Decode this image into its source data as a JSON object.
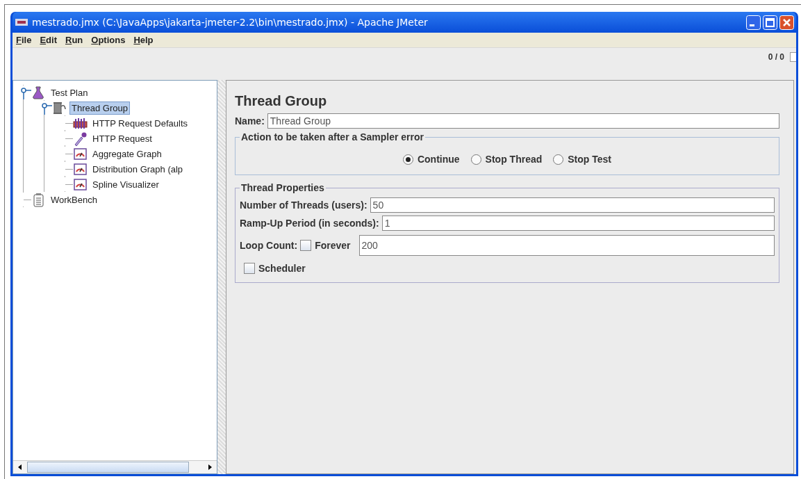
{
  "window": {
    "title": "mestrado.jmx (C:\\JavaApps\\jakarta-jmeter-2.2\\bin\\mestrado.jmx) - Apache JMeter"
  },
  "menu": [
    "File",
    "Edit",
    "Run",
    "Options",
    "Help"
  ],
  "toolbar": {
    "counter": "0 / 0"
  },
  "tree": [
    {
      "label": "Test Plan",
      "kind": "plan",
      "selected": false,
      "expanded": true,
      "children": [
        {
          "label": "Thread Group",
          "kind": "thread-group",
          "selected": true,
          "expanded": true,
          "children": [
            {
              "label": "HTTP Request Defaults",
              "kind": "config",
              "selected": false
            },
            {
              "label": "HTTP Request",
              "kind": "sampler",
              "selected": false
            },
            {
              "label": "Aggregate Graph",
              "kind": "graph",
              "selected": false
            },
            {
              "label": "Distribution Graph (alp",
              "kind": "graph",
              "selected": false
            },
            {
              "label": "Spline Visualizer",
              "kind": "graph",
              "selected": false
            }
          ]
        }
      ]
    },
    {
      "label": "WorkBench",
      "kind": "workbench",
      "selected": false
    }
  ],
  "panel": {
    "title": "Thread Group",
    "name_label": "Name:",
    "name_value": "Thread Group",
    "error_group": {
      "legend": "Action to be taken after a Sampler error",
      "options": [
        {
          "label": "Continue",
          "selected": true
        },
        {
          "label": "Stop Thread",
          "selected": false
        },
        {
          "label": "Stop Test",
          "selected": false
        }
      ]
    },
    "properties": {
      "legend": "Thread Properties",
      "fields": [
        {
          "label": "Number of Threads (users):",
          "value": "50"
        },
        {
          "label": "Ramp-Up Period (in seconds):",
          "value": "1"
        }
      ],
      "loop": {
        "label": "Loop Count:",
        "forever": {
          "label": "Forever",
          "checked": false
        },
        "value": "200"
      },
      "scheduler": {
        "label": "Scheduler",
        "checked": false
      }
    }
  }
}
